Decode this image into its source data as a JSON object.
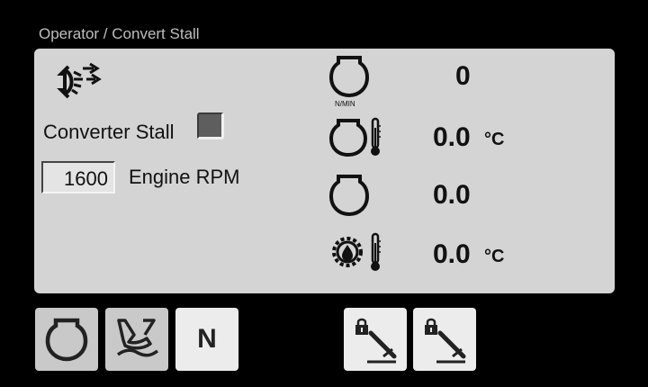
{
  "breadcrumb": "Operator / Convert Stall",
  "stall": {
    "label": "Converter Stall",
    "checked": false
  },
  "rpm": {
    "value": "1600",
    "label": "Engine RPM"
  },
  "readings": {
    "engine_speed": {
      "value": "0",
      "unit_caption": "N/MIN"
    },
    "engine_coolant_temp": {
      "value": "0.0",
      "unit": "°C"
    },
    "engine_load": {
      "value": "0.0"
    },
    "transmission_oil_temp": {
      "value": "0.0",
      "unit": "°C"
    }
  },
  "bottom_buttons": {
    "neutral_label": "N"
  },
  "icons": [
    "converter-icon",
    "engine-icon",
    "engine-temp-icon",
    "engine-icon",
    "gear-oil-temp-icon",
    "engine-button-icon",
    "excavator-icon",
    "locked-pedal-icon",
    "locked-pedal-icon"
  ],
  "colors": {
    "background": "#000000",
    "panel": "#d4d4d4",
    "button_gray": "#c9c9c9",
    "button_light": "#ececec"
  }
}
